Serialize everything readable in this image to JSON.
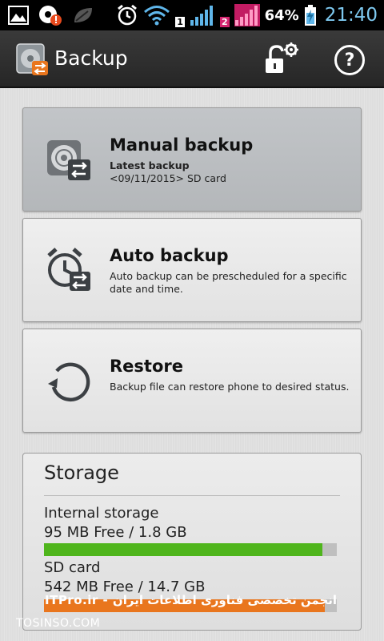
{
  "status_bar": {
    "battery_percent": "64%",
    "time": "21:40",
    "sim1_label": "1",
    "sim2_label": "2",
    "icons": [
      "image-icon",
      "notification-badge-icon",
      "leaf-icon",
      "alarm-clock-icon",
      "wifi-icon",
      "signal-sim1-icon",
      "signal-sim2-icon",
      "battery-charging-icon"
    ]
  },
  "action_bar": {
    "title": "Backup",
    "lock_icon": "lock-settings-icon",
    "help_label": "?"
  },
  "cards": [
    {
      "title": "Manual backup",
      "subtitle_bold": "Latest backup",
      "subtitle": "<09/11/2015> SD card",
      "icon": "disk-backup-icon"
    },
    {
      "title": "Auto backup",
      "subtitle": "Auto backup can be prescheduled for a specific date and time.",
      "icon": "alarm-backup-icon"
    },
    {
      "title": "Restore",
      "subtitle": "Backup file can restore phone to desired status.",
      "icon": "restore-icon"
    }
  ],
  "storage": {
    "title": "Storage",
    "internal": {
      "label": "Internal storage",
      "value": "95 MB Free / 1.8 GB",
      "used_fraction": 0.95,
      "color": "#4fb51c"
    },
    "sd": {
      "label": "SD card",
      "value": "542 MB Free / 14.7 GB",
      "used_fraction": 0.96,
      "color": "#e9761e"
    }
  },
  "watermark": {
    "top": "ITPro.ir - انجمن تخصصی فناوری اطلاعات ایران",
    "bottom": "TOSINSO.COM"
  },
  "colors": {
    "time": "#7ec9f0",
    "action_bar": "#2e2e2e",
    "active_card": "#b9bcbf"
  }
}
